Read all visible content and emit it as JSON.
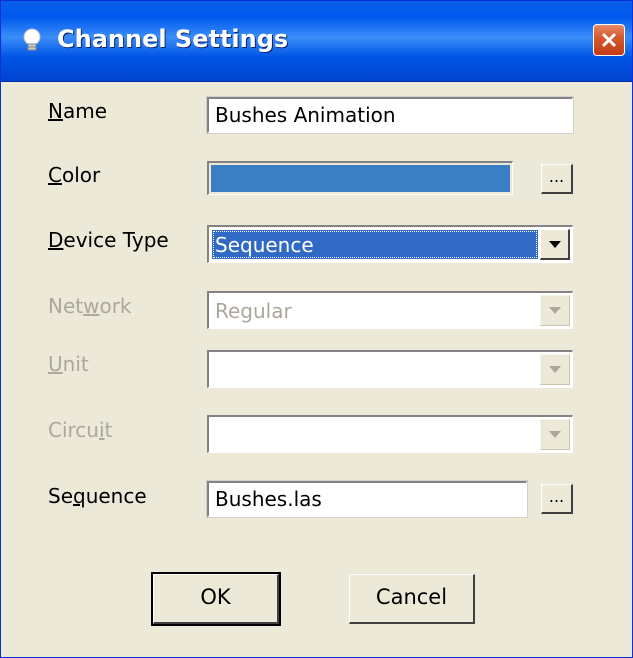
{
  "window": {
    "title": "Channel Settings",
    "icon": "lightbulb-icon",
    "close_icon": "close-icon"
  },
  "fields": {
    "name": {
      "label": "Name",
      "accel": "N",
      "label_rest": "ame",
      "value": "Bushes Animation"
    },
    "color": {
      "label": "Color",
      "accel": "C",
      "label_rest": "olor",
      "swatch": "#3a7fc4",
      "button": "..."
    },
    "device_type": {
      "label": "Device Type",
      "accel": "D",
      "label_rest": "evice Type",
      "value": "Sequence"
    },
    "network": {
      "label": "Network",
      "pre": "Net",
      "accel": "w",
      "post": "ork",
      "value": "Regular"
    },
    "unit": {
      "label": "Unit",
      "accel": "U",
      "label_rest": "nit",
      "value": ""
    },
    "circuit": {
      "label": "Circuit",
      "pre": "Circu",
      "accel": "i",
      "post": "t",
      "value": ""
    },
    "sequence": {
      "label": "Sequence",
      "pre": "Se",
      "accel": "q",
      "post": "uence",
      "value": "Bushes.las",
      "button": "..."
    }
  },
  "buttons": {
    "ok": "OK",
    "cancel": "Cancel"
  }
}
